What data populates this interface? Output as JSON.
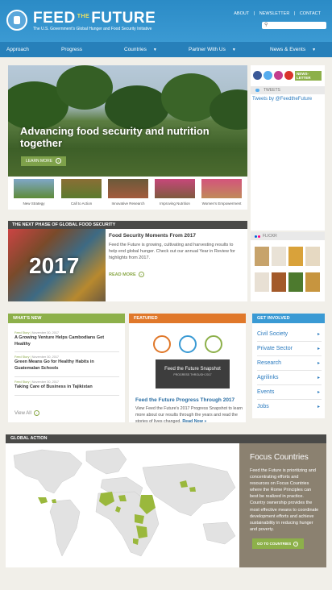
{
  "header": {
    "logo_feed": "FEED",
    "logo_the": "THE",
    "logo_future": "FUTURE",
    "tagline": "The U.S. Government's Global Hunger and Food Security Initiative",
    "links": [
      "ABOUT",
      "|",
      "NEWSLETTER",
      "|",
      "CONTACT"
    ],
    "search_icon": "search-icon"
  },
  "nav": {
    "items": [
      "Approach",
      "Progress",
      "Countries",
      "Partner With Us",
      "News & Events"
    ]
  },
  "hero": {
    "title": "Advancing food security and nutrition together",
    "cta": "LEARN MORE"
  },
  "thumbs": [
    "New Strategy",
    "Call to Action",
    "Innovative Research",
    "Improving Nutrition",
    "Women's Empowerment"
  ],
  "social": {
    "icons": [
      "facebook-icon",
      "twitter-icon",
      "flickr-icon",
      "youtube-icon"
    ],
    "newsletter": "NEWS- LETTER",
    "tweets_label": "TWEETS",
    "tweets_link": "Tweets by @FeedtheFuture"
  },
  "next_phase": {
    "heading": "THE NEXT PHASE OF GLOBAL FOOD SECURITY",
    "year": "2017",
    "title": "Food Security Moments From 2017",
    "body": "Feed the Future is growing, cultivating and harvesting results to help end global hunger. Check out our annual Year in Review for highlights from 2017.",
    "read_more": "READ MORE"
  },
  "flickr_label": "FLICKR",
  "whats_new": {
    "heading": "WHAT'S NEW",
    "items": [
      {
        "type": "Feed Story",
        "date": "November 30, 2017",
        "title": "A Growing Venture Helps Cambodians Get Healthy"
      },
      {
        "type": "Feed Story",
        "date": "November 30, 2017",
        "title": "Green Means Go for Healthy Habits in Guatemalan Schools"
      },
      {
        "type": "Feed Story",
        "date": "November 30, 2017",
        "title": "Taking Care of Business in Tajikistan"
      }
    ],
    "view_all": "View All"
  },
  "featured": {
    "heading": "FEATURED",
    "snapshot_title": "Feed the Future Snapshot",
    "snapshot_sub": "PROGRESS THROUGH 2017",
    "title": "Feed the Future Progress Through 2017",
    "body": "View Feed the Future's 2017 Progress Snapshot to learn more about our results through the years and read the stories of lives changed.",
    "read_now": "Read Now »"
  },
  "get_involved": {
    "heading": "GET INVOLVED",
    "items": [
      "Civil Society",
      "Private Sector",
      "Research",
      "Agrilinks",
      "Events",
      "Jobs"
    ],
    "chevron": "▸"
  },
  "global_action": {
    "heading": "GLOBAL ACTION",
    "focus_title": "Focus Countries",
    "focus_body": "Feed the Future is prioritizing and concentrating efforts and resources on Focus Countries where the Rome Principles can best be realized in practice. Country ownership provides the most effective means to coordinate development efforts and achieve sustainability in reducing hunger and poverty.",
    "button": "GO TO COUNTRIES"
  },
  "colors": {
    "blue": "#2b8bc6",
    "green": "#8db04a",
    "orange": "#e0782a",
    "sky": "#3a9ad4",
    "dark": "#4a4a48",
    "brown": "#8b8170"
  }
}
